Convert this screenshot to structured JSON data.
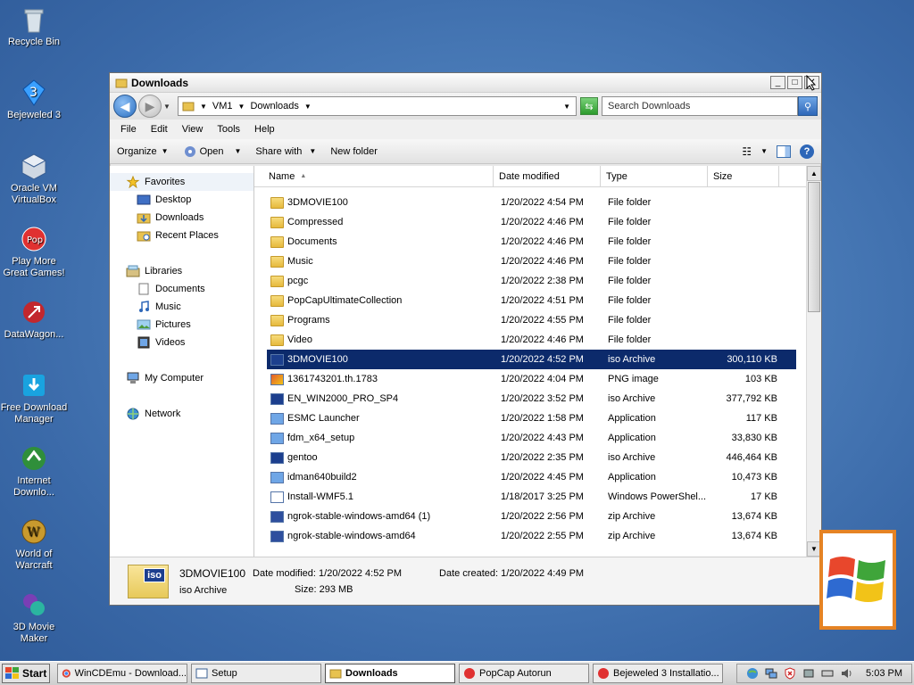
{
  "desktop": {
    "icons": [
      {
        "label": "Recycle Bin"
      },
      {
        "label": "Bejeweled 3"
      },
      {
        "label": "Oracle VM VirtualBox"
      },
      {
        "label": "Play More Great Games!"
      },
      {
        "label": "DataWagon..."
      },
      {
        "label": "Free Download Manager"
      },
      {
        "label": "Internet Downlo..."
      },
      {
        "label": "World of Warcraft"
      },
      {
        "label": "3D Movie Maker"
      }
    ]
  },
  "window": {
    "title": "Downloads",
    "address": {
      "seg1": "VM1",
      "seg2": "Downloads"
    },
    "search_placeholder": "Search Downloads",
    "menu": [
      "File",
      "Edit",
      "View",
      "Tools",
      "Help"
    ],
    "toolbar": {
      "organize": "Organize",
      "open": "Open",
      "share": "Share with",
      "new_folder": "New folder"
    },
    "nav": {
      "favorites": "Favorites",
      "desktop": "Desktop",
      "downloads": "Downloads",
      "recent": "Recent Places",
      "libraries": "Libraries",
      "documents": "Documents",
      "music": "Music",
      "pictures": "Pictures",
      "videos": "Videos",
      "computer": "My Computer",
      "network": "Network"
    },
    "columns": {
      "name": "Name",
      "date": "Date modified",
      "type": "Type",
      "size": "Size"
    },
    "files": [
      {
        "name": "3DMOVIE100",
        "date": "1/20/2022 4:54 PM",
        "type": "File folder",
        "size": "",
        "kind": "folder"
      },
      {
        "name": "Compressed",
        "date": "1/20/2022 4:46 PM",
        "type": "File folder",
        "size": "",
        "kind": "folder"
      },
      {
        "name": "Documents",
        "date": "1/20/2022 4:46 PM",
        "type": "File folder",
        "size": "",
        "kind": "folder"
      },
      {
        "name": "Music",
        "date": "1/20/2022 4:46 PM",
        "type": "File folder",
        "size": "",
        "kind": "folder"
      },
      {
        "name": "pcgc",
        "date": "1/20/2022 2:38 PM",
        "type": "File folder",
        "size": "",
        "kind": "folder"
      },
      {
        "name": "PopCapUltimateCollection",
        "date": "1/20/2022 4:51 PM",
        "type": "File folder",
        "size": "",
        "kind": "folder"
      },
      {
        "name": "Programs",
        "date": "1/20/2022 4:55 PM",
        "type": "File folder",
        "size": "",
        "kind": "folder"
      },
      {
        "name": "Video",
        "date": "1/20/2022 4:46 PM",
        "type": "File folder",
        "size": "",
        "kind": "folder"
      },
      {
        "name": "3DMOVIE100",
        "date": "1/20/2022 4:52 PM",
        "type": "iso Archive",
        "size": "300,110 KB",
        "kind": "iso"
      },
      {
        "name": "1361743201.th.1783",
        "date": "1/20/2022 4:04 PM",
        "type": "PNG image",
        "size": "103 KB",
        "kind": "png"
      },
      {
        "name": "EN_WIN2000_PRO_SP4",
        "date": "1/20/2022 3:52 PM",
        "type": "iso Archive",
        "size": "377,792 KB",
        "kind": "iso"
      },
      {
        "name": "ESMC Launcher",
        "date": "1/20/2022 1:58 PM",
        "type": "Application",
        "size": "117 KB",
        "kind": "app"
      },
      {
        "name": "fdm_x64_setup",
        "date": "1/20/2022 4:43 PM",
        "type": "Application",
        "size": "33,830 KB",
        "kind": "app"
      },
      {
        "name": "gentoo",
        "date": "1/20/2022 2:35 PM",
        "type": "iso Archive",
        "size": "446,464 KB",
        "kind": "iso"
      },
      {
        "name": "idman640build2",
        "date": "1/20/2022 4:45 PM",
        "type": "Application",
        "size": "10,473 KB",
        "kind": "app"
      },
      {
        "name": "Install-WMF5.1",
        "date": "1/18/2017 3:25 PM",
        "type": "Windows PowerShel...",
        "size": "17 KB",
        "kind": "ps"
      },
      {
        "name": "ngrok-stable-windows-amd64 (1)",
        "date": "1/20/2022 2:56 PM",
        "type": "zip Archive",
        "size": "13,674 KB",
        "kind": "zip"
      },
      {
        "name": "ngrok-stable-windows-amd64",
        "date": "1/20/2022 2:55 PM",
        "type": "zip Archive",
        "size": "13,674 KB",
        "kind": "zip"
      }
    ],
    "details": {
      "name": "3DMOVIE100",
      "type": "iso Archive",
      "modified_label": "Date modified:",
      "modified": "1/20/2022 4:52 PM",
      "size_label": "Size:",
      "size": "293 MB",
      "created_label": "Date created:",
      "created": "1/20/2022 4:49 PM",
      "icon_text": "iso"
    }
  },
  "taskbar": {
    "start": "Start",
    "tasks": [
      {
        "label": "WinCDEmu - Download..."
      },
      {
        "label": "Setup"
      },
      {
        "label": "Downloads"
      },
      {
        "label": "PopCap Autorun"
      },
      {
        "label": "Bejeweled 3 Installatio..."
      }
    ],
    "clock": "5:03 PM"
  },
  "colors": {
    "selection": "#0c2a6b",
    "taskbar": "#dcdcdc",
    "accent": "#e58324"
  }
}
